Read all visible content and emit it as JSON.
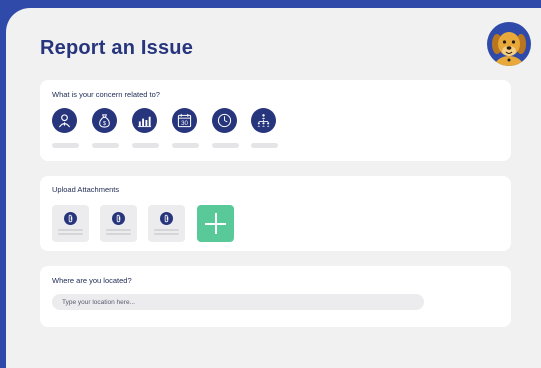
{
  "header": {
    "title": "Report an Issue"
  },
  "avatar": {
    "icon": "dog-avatar-icon"
  },
  "concern": {
    "title": "What is your concern related to?",
    "categories": [
      {
        "icon": "person-icon"
      },
      {
        "icon": "money-bag-icon"
      },
      {
        "icon": "bar-chart-icon"
      },
      {
        "icon": "calendar-icon",
        "text": "30"
      },
      {
        "icon": "clock-icon"
      },
      {
        "icon": "hierarchy-icon"
      }
    ]
  },
  "attachments": {
    "title": "Upload Attachments",
    "items": [
      {
        "icon": "paperclip-icon"
      },
      {
        "icon": "paperclip-icon"
      },
      {
        "icon": "paperclip-icon"
      }
    ],
    "add_icon": "plus-icon"
  },
  "location": {
    "title": "Where are you located?",
    "placeholder": "Type your location here...",
    "value": ""
  },
  "colors": {
    "background": "#2f4aa8",
    "panel": "#f1f1f2",
    "accent": "#27357c",
    "add_button": "#59c99a",
    "avatar_dog": "#e8a93a"
  }
}
